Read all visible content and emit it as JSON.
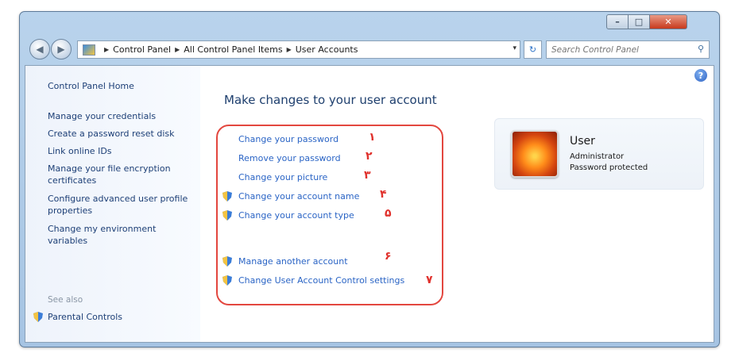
{
  "window": {
    "controls": {
      "minimize": "–",
      "maximize": "□",
      "close": "✕"
    }
  },
  "nav": {
    "back_glyph": "◀",
    "forward_glyph": "▶",
    "breadcrumbs": [
      "Control Panel",
      "All Control Panel Items",
      "User Accounts"
    ],
    "separator": "▶",
    "dropdown_glyph": "▾",
    "refresh_glyph": "↻",
    "search_placeholder": "Search Control Panel",
    "search_glyph": "⚲"
  },
  "sidebar": {
    "home": "Control Panel Home",
    "links": [
      "Manage your credentials",
      "Create a password reset disk",
      "Link online IDs",
      "Manage your file encryption certificates",
      "Configure advanced user profile properties",
      "Change my environment variables"
    ],
    "see_also": "See also",
    "parental_controls": "Parental Controls"
  },
  "main": {
    "title": "Make changes to your user account",
    "tasks": [
      {
        "label": "Change your password",
        "number": "١",
        "shield": false
      },
      {
        "label": "Remove your password",
        "number": "٢",
        "shield": false
      },
      {
        "label": "Change your picture",
        "number": "٣",
        "shield": false
      },
      {
        "label": "Change your account name",
        "number": "۴",
        "shield": true
      },
      {
        "label": "Change your account type",
        "number": "۵",
        "shield": true
      },
      {
        "label": "Manage another account",
        "number": "۶",
        "shield": true
      },
      {
        "label": "Change User Account Control settings",
        "number": "٧",
        "shield": true
      }
    ]
  },
  "user": {
    "name": "User",
    "role": "Administrator",
    "status": "Password protected"
  },
  "help_glyph": "?",
  "colors": {
    "link": "#2a64c5",
    "sidebar_link": "#1d3f76",
    "highlight": "#e3473f",
    "title": "#1e3f6e"
  }
}
